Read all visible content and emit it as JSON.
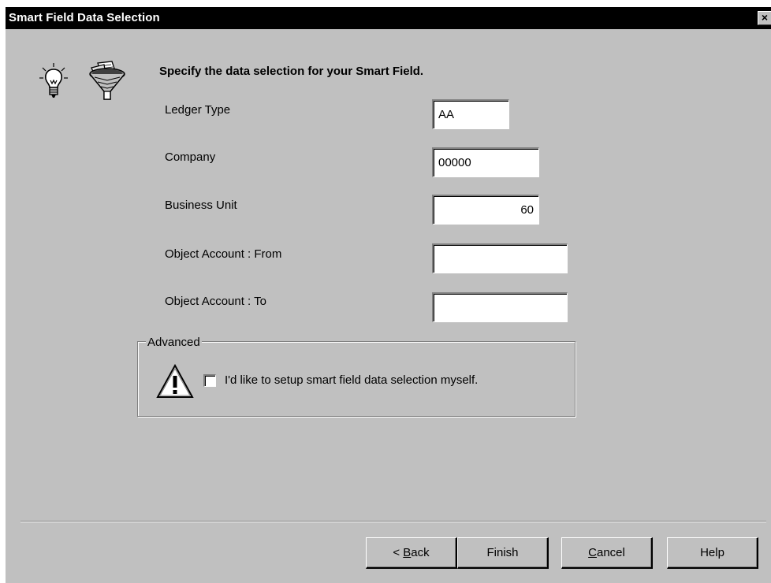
{
  "window": {
    "title": "Smart Field Data Selection",
    "close_glyph": "×"
  },
  "icons": {
    "bulb": "lightbulb-icon",
    "funnel": "funnel-icon",
    "warning": "warning-icon"
  },
  "heading": "Specify the data selection for your Smart Field.",
  "fields": [
    {
      "label": "Ledger Type",
      "value": "AA"
    },
    {
      "label": "Company",
      "value": "00000"
    },
    {
      "label": "Business Unit",
      "value": "60"
    },
    {
      "label": "Object Account : From",
      "value": ""
    },
    {
      "label": "Object Account : To",
      "value": ""
    }
  ],
  "advanced": {
    "legend": "Advanced",
    "checkbox_label": "I'd like to setup smart field data selection myself.",
    "checked": false
  },
  "buttons": {
    "back_prefix": "< ",
    "back_accel": "B",
    "back_rest": "ack",
    "finish": "Finish",
    "cancel_accel": "C",
    "cancel_rest": "ancel",
    "help": "Help"
  },
  "colors": {
    "face": "#c0c0c0",
    "titlebar": "#000000",
    "field": "#ffffff"
  }
}
